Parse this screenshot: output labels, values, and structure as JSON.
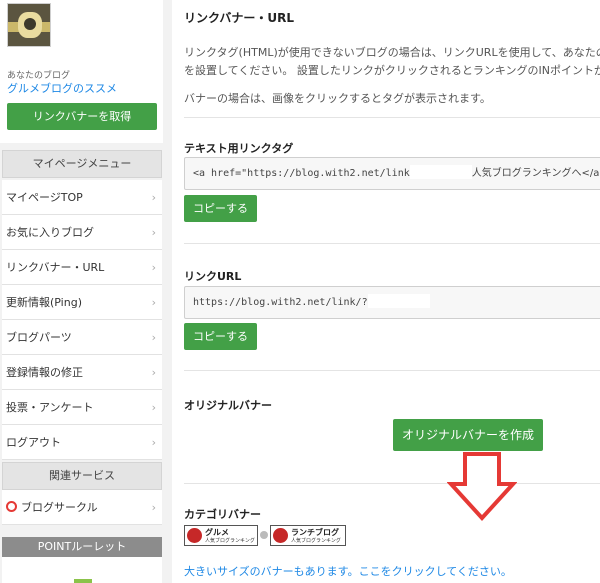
{
  "sidebar": {
    "blog_label": "あなたのブログ",
    "blog_name": "グルメブログのススメ",
    "get_banner_button": "リンクバナーを取得",
    "mypage_menu_title": "マイページメニュー",
    "menu_items": [
      {
        "label": "マイページTOP"
      },
      {
        "label": "お気に入りブログ"
      },
      {
        "label": "リンクバナー・URL"
      },
      {
        "label": "更新情報(Ping)"
      },
      {
        "label": "ブログパーツ"
      },
      {
        "label": "登録情報の修正"
      },
      {
        "label": "投票・アンケート"
      },
      {
        "label": "ログアウト"
      }
    ],
    "chevron": "›",
    "related_title": "関連サービス",
    "blog_circle": "ブログサークル",
    "point_roulette": "POINTルーレット"
  },
  "main": {
    "title": "リンクバナー・URL",
    "desc_line1": "リンクタグ(HTML)が使用できないブログの場合は、リンクURLを使用して、あなたのブ",
    "desc_line2": "を設置してください。 設置したリンクがクリックされるとランキングのINポイントが",
    "desc_line3": "バナーの場合は、画像をクリックするとタグが表示されます。",
    "text_link_title": "テキスト用リンクタグ",
    "text_link_code_prefix": "<a href=\"https://blog.with2.net/link",
    "text_link_code_suffix": "人気ブログランキングへ</a>",
    "copy_label": "コピーする",
    "link_url_title": "リンクURL",
    "link_url_value": "https://blog.with2.net/link/?",
    "original_banner_title": "オリジナルバナー",
    "create_original_button": "オリジナルバナーを作成",
    "category_banner_title": "カテゴリバナー",
    "banners": [
      {
        "big": "グルメ",
        "sub": "人気ブログランキング"
      },
      {
        "big": "ランチブログ",
        "sub": "人気ブログランキング"
      }
    ],
    "more_sizes_link": "大きいサイズのバナーもあります。ここをクリックしてください。"
  },
  "colors": {
    "accent_green": "#43a047",
    "link_blue": "#1e88e5",
    "arrow_red": "#e53935"
  }
}
